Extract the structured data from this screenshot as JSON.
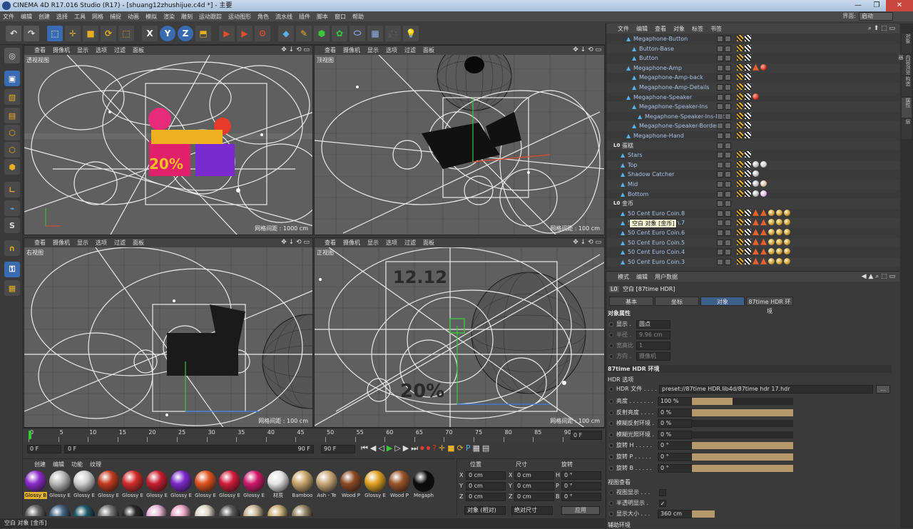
{
  "window": {
    "title": "CINEMA 4D R17.016 Studio (R17) - [shuang12zhushijue.c4d *] - 主要",
    "layout_label": "界面:",
    "layout_value": "启动",
    "controls": [
      "—",
      "❐",
      "✕"
    ]
  },
  "menu": [
    "文件",
    "编辑",
    "创建",
    "选择",
    "工具",
    "网格",
    "捕捉",
    "动画",
    "模拟",
    "渲染",
    "雕刻",
    "运动跟踪",
    "运动图形",
    "角色",
    "流水线",
    "插件",
    "脚本",
    "窗口",
    "帮助"
  ],
  "viewport_menu": [
    "查看",
    "摄像机",
    "显示",
    "选项",
    "过滤",
    "面板"
  ],
  "viewports": [
    {
      "name": "透视视图",
      "grid": "网格间距 : 1000 cm"
    },
    {
      "name": "顶视图",
      "grid": "网格间距 : 100 cm"
    },
    {
      "name": "右视图",
      "grid": "网格间距 : 100 cm"
    },
    {
      "name": "正视图",
      "grid": "网格间距 : 100 cm"
    }
  ],
  "timeline": {
    "ticks": [
      "0",
      "5",
      "10",
      "15",
      "20",
      "25",
      "30",
      "35",
      "40",
      "45",
      "50",
      "55",
      "60",
      "65",
      "70",
      "75",
      "80",
      "85",
      "90"
    ],
    "current_frame": "0 F",
    "start": "0 F",
    "min": "0 F",
    "max": "90 F",
    "end": "90 F"
  },
  "materials": {
    "menu": [
      "创建",
      "编辑",
      "功能",
      "纹理"
    ],
    "items": [
      {
        "label": "Glossy B",
        "color": "#8a2ac9"
      },
      {
        "label": "Glossy E",
        "color": "#b8b8b8"
      },
      {
        "label": "Glossy E",
        "color": "#d0d0d0"
      },
      {
        "label": "Glossy E",
        "color": "#c23a1c"
      },
      {
        "label": "Glossy E",
        "color": "#d02a2a"
      },
      {
        "label": "Glossy E",
        "color": "#c81e2e"
      },
      {
        "label": "Glossy E",
        "color": "#7a28c8"
      },
      {
        "label": "Glossy E",
        "color": "#e0521e"
      },
      {
        "label": "Glossy E",
        "color": "#d01c3a"
      },
      {
        "label": "Glossy E",
        "color": "#d0186a"
      },
      {
        "label": "材质",
        "color": "#e4e4e4"
      },
      {
        "label": "Bamboo",
        "color": "#c9a46a"
      },
      {
        "label": "Ash - Te",
        "color": "#c8a878"
      },
      {
        "label": "Wood P",
        "color": "#8a4a24"
      },
      {
        "label": "Glossy E",
        "color": "#e0a020"
      },
      {
        "label": "Wood P",
        "color": "#9a5428"
      },
      {
        "label": "Megaph",
        "color": "#0a0a0a"
      }
    ],
    "row2": [
      "#6a6a6a",
      "#4a6a8a",
      "#1e5a6a",
      "#7a7a7a",
      "#2a2a2a",
      "#e8b8d8",
      "#e8a8c8",
      "#e0d8c8",
      "#5a5a5a",
      "#c8b898",
      "#c8b078",
      "#9a8a6a"
    ]
  },
  "coords": {
    "headers": [
      "位置",
      "尺寸",
      "旋转"
    ],
    "rows": [
      {
        "axis": "X",
        "pos": "0 cm",
        "size": "0 cm",
        "rot_axis": "H",
        "rot": "0 °"
      },
      {
        "axis": "Y",
        "pos": "0 cm",
        "size": "0 cm",
        "rot_axis": "P",
        "rot": "0 °"
      },
      {
        "axis": "Z",
        "pos": "0 cm",
        "size": "0 cm",
        "rot_axis": "B",
        "rot": "0 °"
      }
    ],
    "mode": "对象 (相对)",
    "size_mode": "绝对尺寸",
    "apply": "应用"
  },
  "status": "空白 对象 [金币]",
  "object_manager": {
    "menu": [
      "文件",
      "编辑",
      "查看",
      "对象",
      "标签",
      "书签"
    ],
    "tooltip": "空白 对象 [金币]",
    "rows": [
      {
        "name": "Megaphone-Button",
        "indent": 2
      },
      {
        "name": "Button-Base",
        "indent": 3
      },
      {
        "name": "Button",
        "indent": 3
      },
      {
        "name": "Megaphone-Amp",
        "indent": 2
      },
      {
        "name": "Megaphone-Amp-back",
        "indent": 3
      },
      {
        "name": "Megaphone-Amp-Details",
        "indent": 3
      },
      {
        "name": "Megaphone-Speaker",
        "indent": 2
      },
      {
        "name": "Megaphone-Speaker-Ins",
        "indent": 3
      },
      {
        "name": "Megaphone-Speaker-Ins-Ext",
        "indent": 4
      },
      {
        "name": "Megaphone-Speaker-Borders",
        "indent": 3
      },
      {
        "name": "Megaphone-Hand",
        "indent": 2
      },
      {
        "name": "蛋糕",
        "indent": 0
      },
      {
        "name": "Stars",
        "indent": 1
      },
      {
        "name": "Top",
        "indent": 1
      },
      {
        "name": "Shadow Catcher",
        "indent": 1
      },
      {
        "name": "Mid",
        "indent": 1
      },
      {
        "name": "Bottom",
        "indent": 1
      },
      {
        "name": "金币",
        "indent": 0
      },
      {
        "name": "50 Cent Euro Coin.8",
        "indent": 1
      },
      {
        "name": "50 Cent Euro Coin.7",
        "indent": 1
      },
      {
        "name": "50 Cent Euro Coin.6",
        "indent": 1
      },
      {
        "name": "50 Cent Euro Coin.5",
        "indent": 1
      },
      {
        "name": "50 Cent Euro Coin.4",
        "indent": 1
      },
      {
        "name": "50 Cent Euro Coin.3",
        "indent": 1
      }
    ]
  },
  "attributes": {
    "menu": [
      "模式",
      "编辑",
      "用户数据"
    ],
    "object_title": "空白 [87time HDR]",
    "tabs": [
      "基本",
      "坐标",
      "对象",
      "87time HDR 环境"
    ],
    "section_object": "对象属性",
    "object_props": [
      {
        "label": "显示 .",
        "value": "圆点"
      },
      {
        "label": "半径 .",
        "value": "9.96 cm"
      },
      {
        "label": "宽高比",
        "value": "1"
      },
      {
        "label": "方向 .",
        "value": "摄像机"
      }
    ],
    "section_hdr": "87time HDR 环境",
    "section_hdr_options": "HDR 选项",
    "hdr_file_label": "HDR 文件 . . . . . .",
    "hdr_file_value": "preset://87time HDR.lib4d/87time hdr 17.hdr",
    "sliders": [
      {
        "label": "亮度 . . . . . . .",
        "value": "100 %",
        "fill": 0.4
      },
      {
        "label": "反射亮度 . . . .",
        "value": "0 %",
        "fill": 1.0
      },
      {
        "label": "模糊反射环境 .",
        "value": "0 %",
        "fill": 0.0
      },
      {
        "label": "模糊光照环境 .",
        "value": "0 %",
        "fill": 0.0
      },
      {
        "label": "旋转 H . . . . .",
        "value": "0 °",
        "fill": 1.0
      },
      {
        "label": "旋转 P . . . . .",
        "value": "0 °",
        "fill": 1.0
      },
      {
        "label": "旋转 B . . . . .",
        "value": "0 °",
        "fill": 1.0
      }
    ],
    "section_view": "视图查看",
    "view_props": [
      {
        "label": "视图显示 . . .",
        "value": ""
      },
      {
        "label": "半透明显示 .",
        "value": "✓"
      },
      {
        "label": "显示大小 . . .",
        "value": "360 cm"
      }
    ],
    "section_env": "辅助环境"
  },
  "right_tabs": [
    "对象",
    "内容浏览器",
    "构造",
    "属性",
    "层"
  ]
}
